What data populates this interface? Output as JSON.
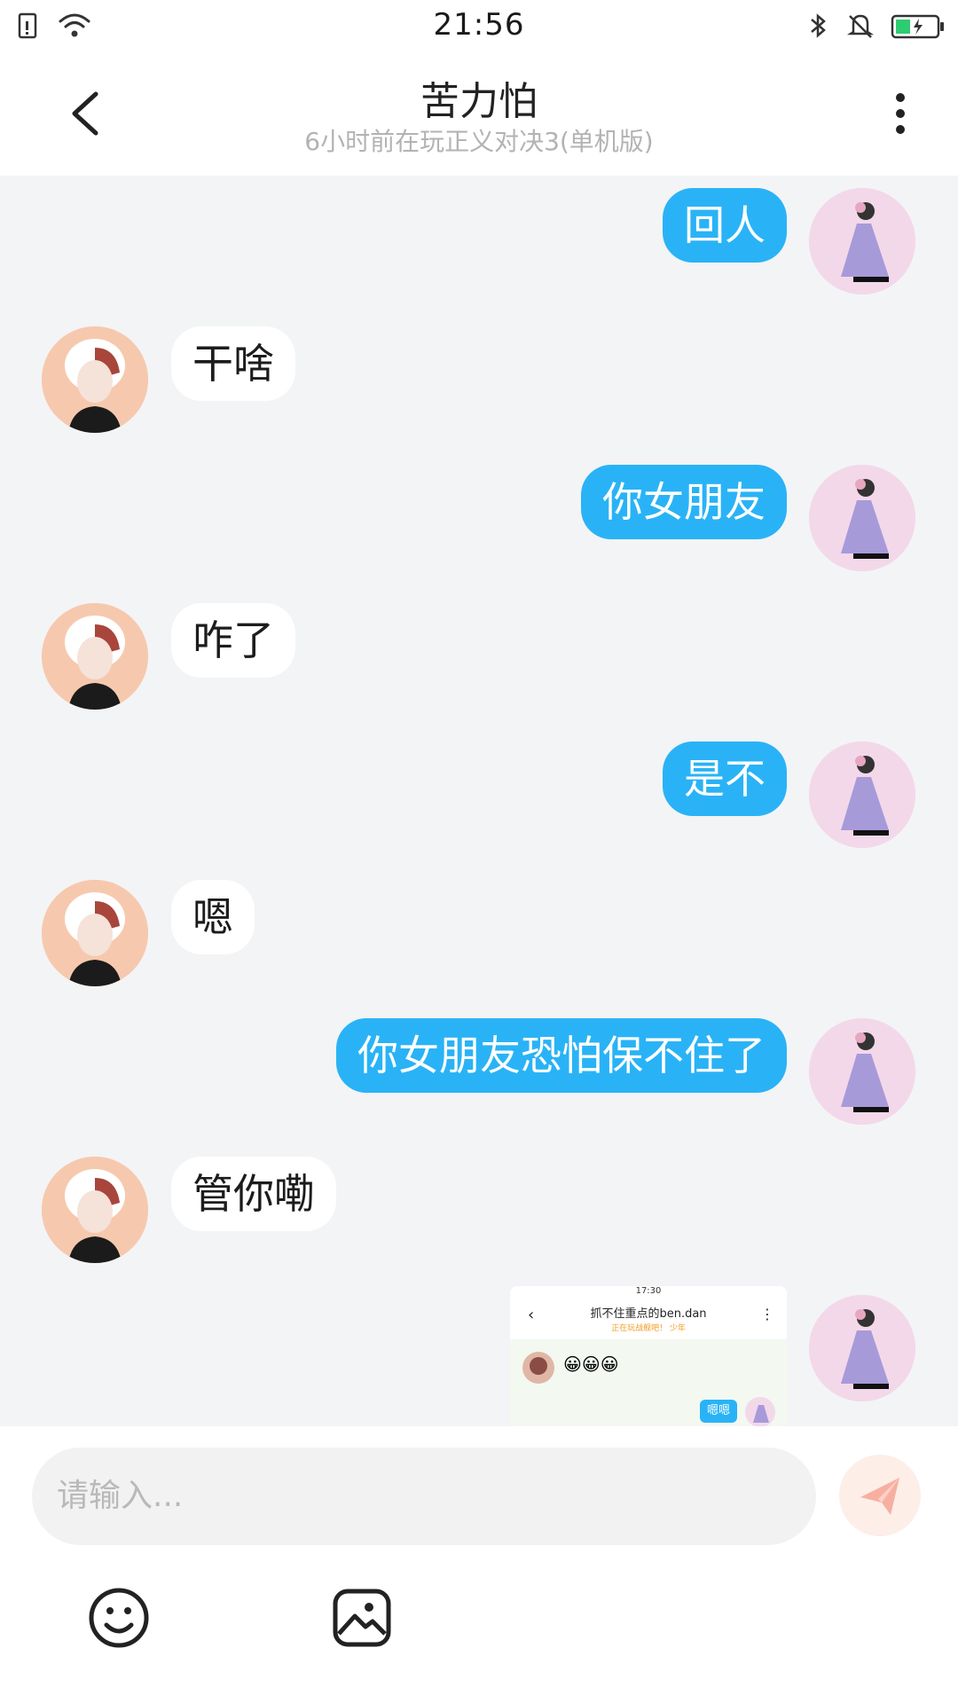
{
  "status_bar": {
    "time": "21:56"
  },
  "header": {
    "title": "苦力怕",
    "subtitle": "6小时前在玩正义对决3(单机版)"
  },
  "messages": [
    {
      "from": "me",
      "text": "回人"
    },
    {
      "from": "them",
      "text": "干啥"
    },
    {
      "from": "me",
      "text": "你女朋友"
    },
    {
      "from": "them",
      "text": "咋了"
    },
    {
      "from": "me",
      "text": "是不"
    },
    {
      "from": "them",
      "text": "嗯"
    },
    {
      "from": "me",
      "text": "你女朋友恐怕保不住了"
    },
    {
      "from": "them",
      "text": "管你嘞"
    }
  ],
  "screenshot_message": {
    "time": "17:30",
    "title": "抓不住重点的ben.dan",
    "subtitle": "正在玩战舰吧！ 少年",
    "emoji": "😀😀😀",
    "bubble": "嗯嗯"
  },
  "input": {
    "placeholder": "请输入..."
  },
  "colors": {
    "my_bubble": "#29b3f6",
    "their_bubble": "#ffffff",
    "chat_background": "#f3f4f6",
    "send_button": "#fdeee8"
  },
  "icons": {
    "back": "back-arrow-icon",
    "more": "more-vertical-icon",
    "send": "paper-plane-icon",
    "emoji": "smiley-icon",
    "image": "image-icon"
  }
}
